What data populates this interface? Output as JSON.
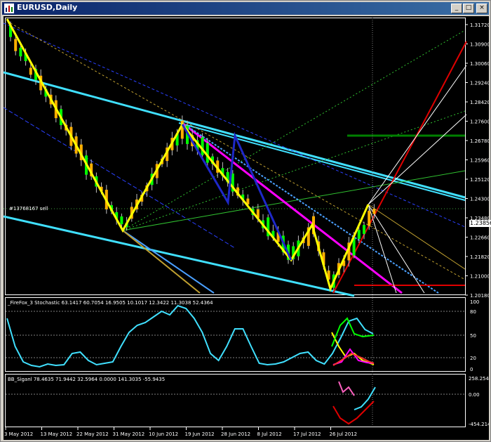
{
  "window": {
    "title": "EURUSD,Daily",
    "buttons": {
      "minimize": "_",
      "maximize": "□",
      "close": "×"
    }
  },
  "colors": {
    "background": "#000000",
    "bull_candle": "#00ff00",
    "bear_candle": "#ffb000",
    "zigzag": "#ffff00",
    "channel": "#40e0ff",
    "magenta_line": "#ff00ff",
    "blue_line": "#1e28c8",
    "stochastic": "#40e0ff",
    "red_line": "#e00000",
    "dark_green_line": "#008000"
  },
  "main_chart": {
    "price_axis": [
      "1.31720",
      "1.30900",
      "1.30060",
      "1.29240",
      "1.28420",
      "1.27600",
      "1.26780",
      "1.25960",
      "1.25120",
      "1.24300",
      "1.23480",
      "1.22660",
      "1.21820",
      "1.21000",
      "1.20180"
    ],
    "current_price": "1.23856",
    "object_label": "#13768167 sell"
  },
  "stochastic_panel": {
    "label": "_FireFox_3 Stochastic 63.1417 60.7054 16.9505 10.1017 12.3422 11.3038 52.4364",
    "levels": [
      "100",
      "80",
      "50",
      "20",
      "0"
    ]
  },
  "signal_panel": {
    "label": "BB_Siganl 78.4635 71.9442 32.5964 0.0000 141.3035 -55.9435",
    "levels": [
      "258.2543",
      "0.00",
      "-454.214"
    ]
  },
  "time_axis": [
    "3 May 2012",
    "13 May 2012",
    "22 May 2012",
    "31 May 2012",
    "10 Jun 2012",
    "19 Jun 2012",
    "28 Jun 2012",
    "8 Jul 2012",
    "17 Jul 2012",
    "26 Jul 2012"
  ]
}
